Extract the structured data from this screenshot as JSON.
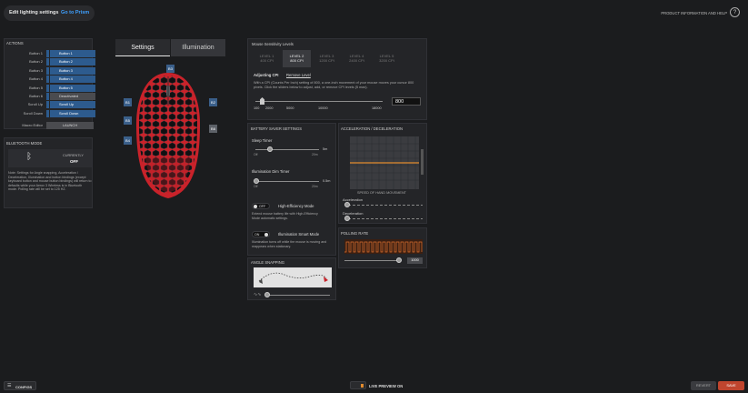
{
  "header": {
    "title": "Edit lighting settings",
    "prism_link": "Go to Prism",
    "help": "PRODUCT INFORMATION AND HELP"
  },
  "tabs": [
    {
      "label": "Settings"
    },
    {
      "label": "Illumination"
    }
  ],
  "actions": {
    "title": "ACTIONS",
    "rows": [
      {
        "label": "Button 1",
        "value": "Button 1"
      },
      {
        "label": "Button 2",
        "value": "Button 2"
      },
      {
        "label": "Button 3",
        "value": "Button 3"
      },
      {
        "label": "Button 4",
        "value": "Button 4"
      },
      {
        "label": "Button 5",
        "value": "Button 5"
      },
      {
        "label": "Button 6",
        "value": "Deactivated"
      },
      {
        "label": "Scroll Up",
        "value": "Scroll Up"
      },
      {
        "label": "Scroll Down",
        "value": "Scroll Down"
      }
    ],
    "macro_label": "Macro Editor",
    "macro_button": "LAUNCH"
  },
  "bluetooth": {
    "title": "BLUETOOTH MODE",
    "currently": "CURRENTLY",
    "state": "OFF",
    "note": "Note: Settings for Angle snapping, Acceleration / Deceleration, Illumination and button bindings (except keyboard button and mouse button bindings) will return to defaults while your Aerox 3 Wireless is in Bluetooth mode. Polling rate will be set to 125 HZ."
  },
  "mouse_labels": [
    "B3",
    "B1",
    "B2",
    "B5",
    "B6",
    "B4"
  ],
  "sensitivity": {
    "title": "Mouse Sensitivity Levels",
    "levels": [
      {
        "name": "LEVEL 1",
        "dpi": "400 CPI"
      },
      {
        "name": "LEVEL 2",
        "dpi": "800 CPI"
      },
      {
        "name": "LEVEL 3",
        "dpi": "1200 CPI"
      },
      {
        "name": "LEVEL 4",
        "dpi": "2400 CPI"
      },
      {
        "name": "LEVEL 5",
        "dpi": "3200 CPI"
      }
    ],
    "adjusting": "Adjusting CPI",
    "remove": "Remove Level",
    "description": "With a CPI (Counts Per Inch) setting of 800, a one-inch movement of your mouse moves your cursor 800 pixels. Click the sliders below to adjust, add, or remove CPI levels (5 max).",
    "ticks": [
      "100",
      "2000",
      "5000",
      "10000",
      "18000"
    ],
    "value": "800"
  },
  "battery": {
    "title": "BATTERY SAVER SETTINGS",
    "sleep_label": "Sleep Timer",
    "sleep_value": "5m",
    "sleep_min": "Off",
    "sleep_max": "20m",
    "dim_label": "Illumination Dim Timer",
    "dim_value": "0.5m",
    "dim_min": "Off",
    "dim_max": "20m",
    "hem_toggle": "OFF",
    "hem_label": "High-Efficiency Mode",
    "hem_desc": "Extend mouse battery life with High-Efficiency Mode automatic settings.",
    "ism_toggle": "ON",
    "ism_label": "Illumination Smart Mode",
    "ism_desc": "Illumination turns off while the mouse is moving and reappears when stationary."
  },
  "accel": {
    "title": "ACCELERATION / DECELERATION",
    "axis": "SPEED OF HAND MOVEMENT",
    "acc_label": "Acceleration",
    "dec_label": "Deceleration"
  },
  "polling": {
    "title": "POLLING RATE",
    "value": "1000"
  },
  "angle": {
    "title": "ANGLE SNAPPING"
  },
  "bottom": {
    "configs": "CONFIGS",
    "live": "LIVE PREVIEW ON",
    "revert": "REVERT",
    "save": "SAVE"
  },
  "colors": {
    "accent": "#2d5b8e",
    "link": "#3ea0ff",
    "save": "#c0452e"
  }
}
